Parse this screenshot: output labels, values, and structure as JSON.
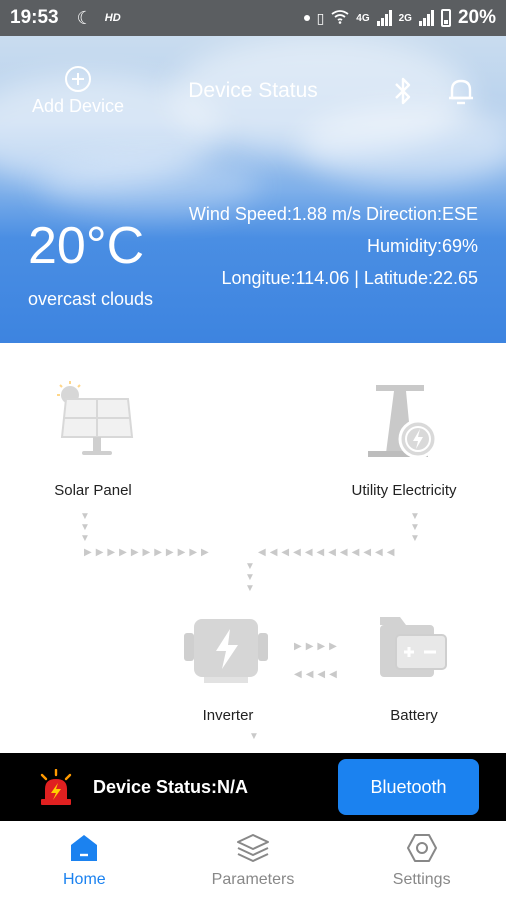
{
  "status_bar": {
    "time": "19:53",
    "hd_label": "HD",
    "net_4g": "4G",
    "net_2g": "2G",
    "battery": "20%"
  },
  "header": {
    "add_device_label": "Add Device",
    "title": "Device Status",
    "bluetooth_icon": "bluetooth-icon",
    "bell_icon": "bell-icon"
  },
  "weather": {
    "temperature": "20°C",
    "condition": "overcast clouds",
    "wind": "Wind Speed:1.88 m/s Direction:ESE",
    "humidity": "Humidity:69%",
    "location": "Longitue:114.06 | Latitude:22.65"
  },
  "flow": {
    "solar_label": "Solar Panel",
    "utility_label": "Utility Electricity",
    "inverter_label": "Inverter",
    "battery_label": "Battery"
  },
  "device_bar": {
    "status_text": "Device Status:N/A",
    "bluetooth_button": "Bluetooth",
    "alert_color": "#e02020"
  },
  "tabs": [
    {
      "label": "Home",
      "icon": "home-icon",
      "active": true
    },
    {
      "label": "Parameters",
      "icon": "layers-icon",
      "active": false
    },
    {
      "label": "Settings",
      "icon": "settings-icon",
      "active": false
    }
  ],
  "colors": {
    "accent": "#1b82f0",
    "header_blue": "#3d84e0"
  }
}
